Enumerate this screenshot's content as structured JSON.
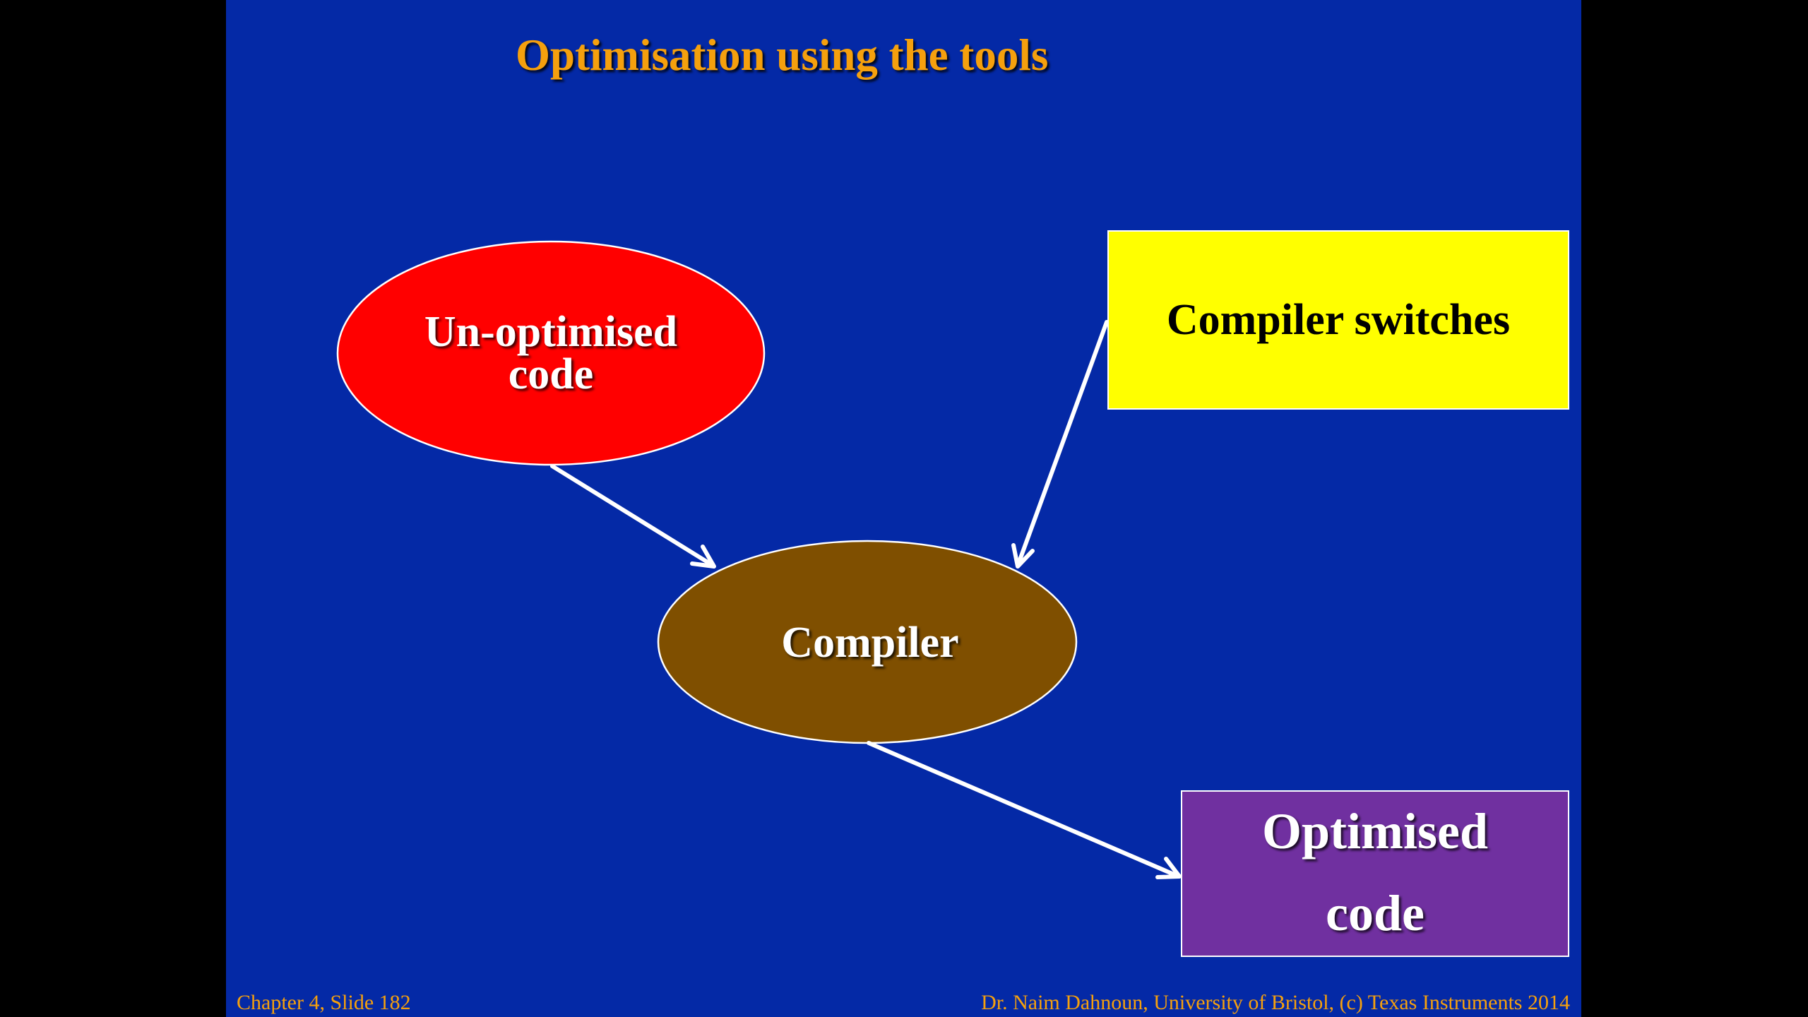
{
  "slide": {
    "title": "Optimisation using the tools",
    "footer_left": "Chapter 4, Slide 182",
    "footer_right": "Dr. Naim Dahnoun, University of Bristol,  (c) Texas Instruments 2014"
  },
  "diagram": {
    "nodes": {
      "unoptimised": {
        "line1": "Un-optimised",
        "line2": "code",
        "fill": "#FF0000",
        "shape": "ellipse"
      },
      "compiler": {
        "label": "Compiler",
        "fill": "#7F4F00",
        "shape": "ellipse"
      },
      "switches": {
        "label": "Compiler switches",
        "fill": "#FFFF00",
        "shape": "rectangle"
      },
      "optimised": {
        "line1": "Optimised",
        "line2": "code",
        "fill": "#7030A0",
        "shape": "rectangle"
      }
    },
    "edges": [
      {
        "from": "Un-optimised code",
        "to": "Compiler"
      },
      {
        "from": "Compiler switches",
        "to": "Compiler"
      },
      {
        "from": "Compiler",
        "to": "Optimised code"
      }
    ]
  },
  "colors": {
    "background": "#0429A6",
    "title": "#F5A00D",
    "footer": "#F5A00D",
    "arrows": "#FFFFFF"
  }
}
